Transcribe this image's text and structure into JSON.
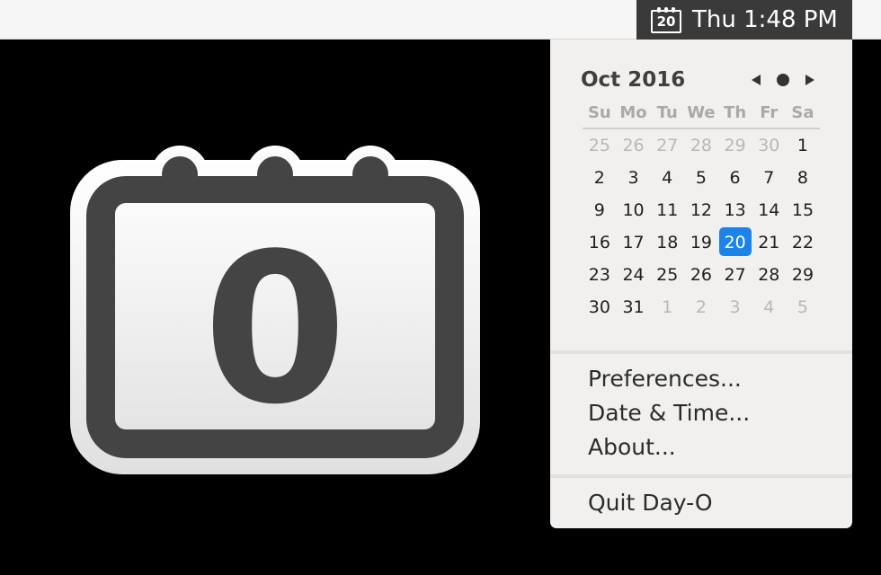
{
  "menubar": {
    "icon_name": "calendar-icon",
    "icon_day": "20",
    "clock": "Thu 1:48 PM"
  },
  "app_icon": {
    "name": "day-o-app-icon",
    "glyph": "0"
  },
  "calendar": {
    "month_title": "Oct 2016",
    "nav": {
      "prev_icon": "triangle-left-icon",
      "today_icon": "dot-icon",
      "next_icon": "triangle-right-icon"
    },
    "weekdays": [
      "Su",
      "Mo",
      "Tu",
      "We",
      "Th",
      "Fr",
      "Sa"
    ],
    "weeks": [
      [
        {
          "d": "25",
          "m": true
        },
        {
          "d": "26",
          "m": true
        },
        {
          "d": "27",
          "m": true
        },
        {
          "d": "28",
          "m": true
        },
        {
          "d": "29",
          "m": true
        },
        {
          "d": "30",
          "m": true
        },
        {
          "d": "1"
        }
      ],
      [
        {
          "d": "2"
        },
        {
          "d": "3"
        },
        {
          "d": "4"
        },
        {
          "d": "5"
        },
        {
          "d": "6"
        },
        {
          "d": "7"
        },
        {
          "d": "8"
        }
      ],
      [
        {
          "d": "9"
        },
        {
          "d": "10"
        },
        {
          "d": "11"
        },
        {
          "d": "12"
        },
        {
          "d": "13"
        },
        {
          "d": "14"
        },
        {
          "d": "15"
        }
      ],
      [
        {
          "d": "16"
        },
        {
          "d": "17"
        },
        {
          "d": "18"
        },
        {
          "d": "19"
        },
        {
          "d": "20",
          "today": true
        },
        {
          "d": "21"
        },
        {
          "d": "22"
        }
      ],
      [
        {
          "d": "23"
        },
        {
          "d": "24"
        },
        {
          "d": "25"
        },
        {
          "d": "26"
        },
        {
          "d": "27"
        },
        {
          "d": "28"
        },
        {
          "d": "29"
        }
      ],
      [
        {
          "d": "30"
        },
        {
          "d": "31"
        },
        {
          "d": "1",
          "m": true
        },
        {
          "d": "2",
          "m": true
        },
        {
          "d": "3",
          "m": true
        },
        {
          "d": "4",
          "m": true
        },
        {
          "d": "5",
          "m": true
        }
      ]
    ],
    "today_color": "#1b84ea"
  },
  "menu": {
    "preferences": "Preferences...",
    "date_time": "Date & Time...",
    "about": "About...",
    "quit": "Quit Day-O"
  }
}
